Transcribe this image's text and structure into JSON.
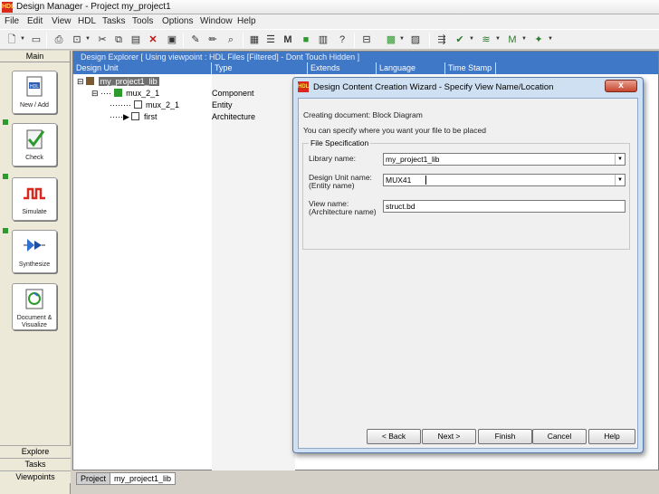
{
  "window": {
    "title": "Design Manager - Project my_project1",
    "icon_text": "HDL"
  },
  "menu": [
    "File",
    "Edit",
    "View",
    "HDL",
    "Tasks",
    "Tools",
    "Options",
    "Window",
    "Help"
  ],
  "left_panel": {
    "header": "Main",
    "buttons": [
      {
        "label": "New / Add",
        "icon": "hdl-document-icon"
      },
      {
        "label": "Check",
        "icon": "check-icon"
      },
      {
        "label": "Simulate",
        "icon": "waveform-icon"
      },
      {
        "label": "Synthesize",
        "icon": "synthesize-icon"
      },
      {
        "label": "Document & Visualize",
        "icon": "document-visualize-icon"
      }
    ],
    "tabs": [
      "Explore",
      "Tasks",
      "Viewpoints"
    ]
  },
  "explorer": {
    "header": "Design Explorer [ Using viewpoint :  HDL Files [Filtered] - Dont Touch Hidden ]",
    "columns": [
      "Design Unit",
      "Type",
      "Extends",
      "Language",
      "Time Stamp"
    ],
    "rows": [
      {
        "name": "my_project1_lib",
        "type": ""
      },
      {
        "name": "mux_2_1",
        "type": "Component"
      },
      {
        "name": "mux_2_1",
        "type": "Entity"
      },
      {
        "name": "first",
        "type": "Architecture"
      }
    ]
  },
  "bottom_tabs": [
    "Project",
    "my_project1_lib"
  ],
  "dialog": {
    "title": "Design Content Creation Wizard - Specify View Name/Location",
    "close": "x",
    "creating": "Creating document: Block Diagram",
    "instruction": "You can specify where you want your file to be placed",
    "group": "File Specification",
    "fields": {
      "library": {
        "label": "Library name:",
        "value": "my_project1_lib"
      },
      "design_unit": {
        "label1": "Design Unit name:",
        "label2": "(Entity name)",
        "value": "MUX41"
      },
      "view": {
        "label1": "View name:",
        "label2": "(Architecture name)",
        "value": "struct.bd"
      }
    },
    "buttons": [
      "< Back",
      "Next >",
      "Finish",
      "Cancel",
      "Help"
    ]
  }
}
